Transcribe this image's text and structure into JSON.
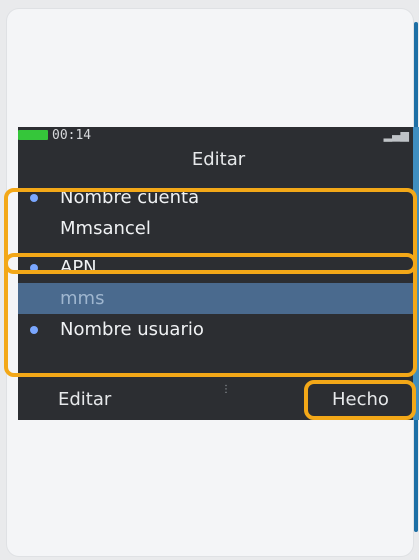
{
  "status": {
    "time": "00:14",
    "signal_icon": "signal-icon",
    "battery_icon": "battery-icon"
  },
  "screen": {
    "title": "Editar",
    "items": [
      {
        "label": "Nombre cuenta",
        "bullet": true
      },
      {
        "label": "Mmsancel",
        "bullet": false
      },
      {
        "label": "APN",
        "bullet": true
      },
      {
        "label": "mms",
        "bullet": false,
        "selected": true
      },
      {
        "label": "Nombre usuario",
        "bullet": true
      }
    ],
    "softkeys": {
      "left": "Editar",
      "right": "Hecho"
    }
  },
  "colors": {
    "highlight": "#f3a818",
    "selected_row": "#4a6a8e",
    "screen_bg": "#2c2e32",
    "battery": "#35c63a"
  }
}
